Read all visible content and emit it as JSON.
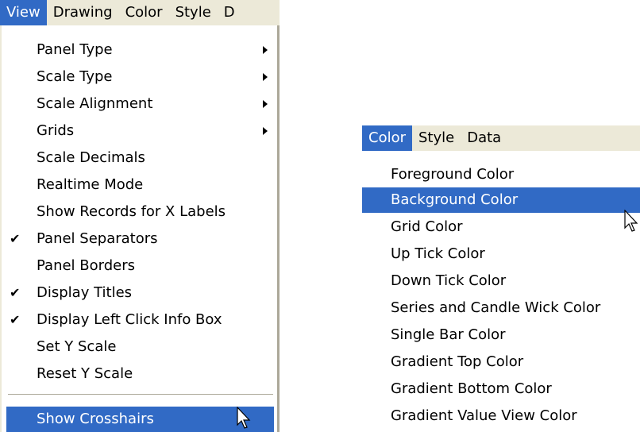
{
  "left_menubar": {
    "items": [
      {
        "label": "View",
        "active": true
      },
      {
        "label": "Drawing",
        "active": false
      },
      {
        "label": "Color",
        "active": false
      },
      {
        "label": "Style",
        "active": false
      },
      {
        "label": "D",
        "active": false
      }
    ]
  },
  "view_menu": {
    "items": [
      {
        "label": "Panel Type",
        "submenu": true,
        "checked": false
      },
      {
        "label": "Scale Type",
        "submenu": true,
        "checked": false
      },
      {
        "label": "Scale Alignment",
        "submenu": true,
        "checked": false
      },
      {
        "label": "Grids",
        "submenu": true,
        "checked": false
      },
      {
        "label": "Scale Decimals",
        "submenu": false,
        "checked": false
      },
      {
        "label": "Realtime Mode",
        "submenu": false,
        "checked": false
      },
      {
        "label": "Show Records for X Labels",
        "submenu": false,
        "checked": false
      },
      {
        "label": "Panel Separators",
        "submenu": false,
        "checked": true
      },
      {
        "label": "Panel Borders",
        "submenu": false,
        "checked": false
      },
      {
        "label": "Display Titles",
        "submenu": false,
        "checked": true
      },
      {
        "label": "Display Left Click Info Box",
        "submenu": false,
        "checked": true
      },
      {
        "label": "Set Y Scale",
        "submenu": false,
        "checked": false
      },
      {
        "label": "Reset Y Scale",
        "submenu": false,
        "checked": false
      }
    ],
    "highlighted_item": {
      "label": "Show Crosshairs"
    }
  },
  "right_menubar": {
    "items": [
      {
        "label": "Color",
        "active": true
      },
      {
        "label": "Style",
        "active": false
      },
      {
        "label": "Data",
        "active": false
      }
    ]
  },
  "color_menu": {
    "items": [
      {
        "label": "Foreground Color",
        "highlighted": false
      },
      {
        "label": "Background Color",
        "highlighted": true
      },
      {
        "label": "Grid Color",
        "highlighted": false
      },
      {
        "label": "Up Tick Color",
        "highlighted": false
      },
      {
        "label": "Down Tick Color",
        "highlighted": false
      },
      {
        "label": "Series and Candle Wick Color",
        "highlighted": false
      },
      {
        "label": "Single Bar Color",
        "highlighted": false
      },
      {
        "label": "Gradient Top Color",
        "highlighted": false
      },
      {
        "label": "Gradient Bottom Color",
        "highlighted": false
      },
      {
        "label": "Gradient Value View Color",
        "highlighted": false
      }
    ]
  },
  "glyphs": {
    "check": "✔"
  },
  "colors": {
    "highlight": "#316ac5",
    "menubar": "#ece9d8",
    "menu_bg": "#ffffff"
  }
}
